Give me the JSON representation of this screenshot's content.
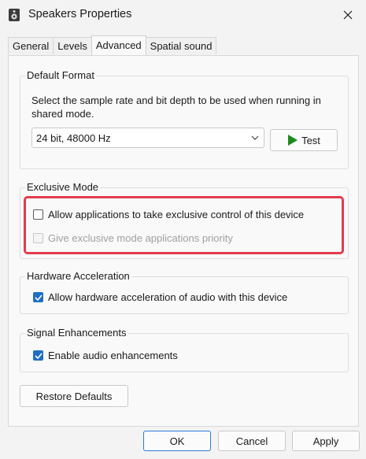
{
  "window": {
    "title": "Speakers Properties"
  },
  "tabs": [
    {
      "label": "General"
    },
    {
      "label": "Levels"
    },
    {
      "label": "Advanced"
    },
    {
      "label": "Spatial sound"
    }
  ],
  "default_format": {
    "legend": "Default Format",
    "description": "Select the sample rate and bit depth to be used when running in shared mode.",
    "selected_format": "24 bit, 48000 Hz",
    "test_label": "Test"
  },
  "exclusive_mode": {
    "legend": "Exclusive Mode",
    "allow_exclusive_label": "Allow applications to take exclusive control of this device",
    "allow_exclusive_checked": false,
    "priority_label": "Give exclusive mode applications priority",
    "priority_checked": false,
    "priority_enabled": false
  },
  "hardware_acceleration": {
    "legend": "Hardware Acceleration",
    "allow_label": "Allow hardware acceleration of audio with this device",
    "allow_checked": true
  },
  "signal_enhancements": {
    "legend": "Signal Enhancements",
    "enable_label": "Enable audio enhancements",
    "enable_checked": true
  },
  "restore_defaults_label": "Restore Defaults",
  "footer": {
    "ok_label": "OK",
    "cancel_label": "Cancel",
    "apply_label": "Apply"
  },
  "colors": {
    "accent": "#1f6fc4",
    "highlight": "#e33c4e",
    "test_icon": "#1e8a1e"
  }
}
